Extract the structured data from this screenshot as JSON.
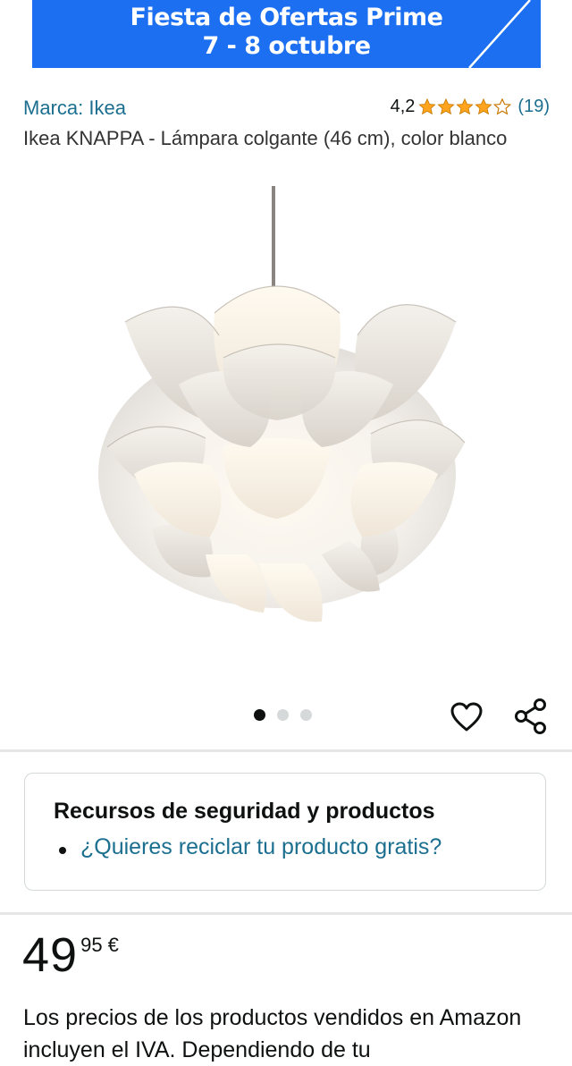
{
  "banner": {
    "line1": "Fiesta de Ofertas Prime",
    "line2": "7 - 8 octubre",
    "color": "#1b6ff0"
  },
  "product": {
    "brand": "Marca: Ikea",
    "rating_value": "4,2",
    "rating_stars": 4.2,
    "rating_count": "(19)",
    "title": "Ikea KNAPPA - Lámpara colgante (46 cm), color blanco"
  },
  "carousel": {
    "image_count": 3,
    "active_index": 0
  },
  "actions": {
    "favorite_icon": "heart-icon",
    "share_icon": "share-icon"
  },
  "safety": {
    "title": "Recursos de seguridad y productos",
    "link": "¿Quieres reciclar tu producto gratis?"
  },
  "price": {
    "whole": "49",
    "fraction": "95 €"
  },
  "disclaimer": "Los precios de los productos vendidos en Amazon incluyen el IVA. Dependiendo de tu",
  "colors": {
    "link": "#1c6f8f",
    "star": "#ffa41c",
    "text": "#0f1111"
  }
}
